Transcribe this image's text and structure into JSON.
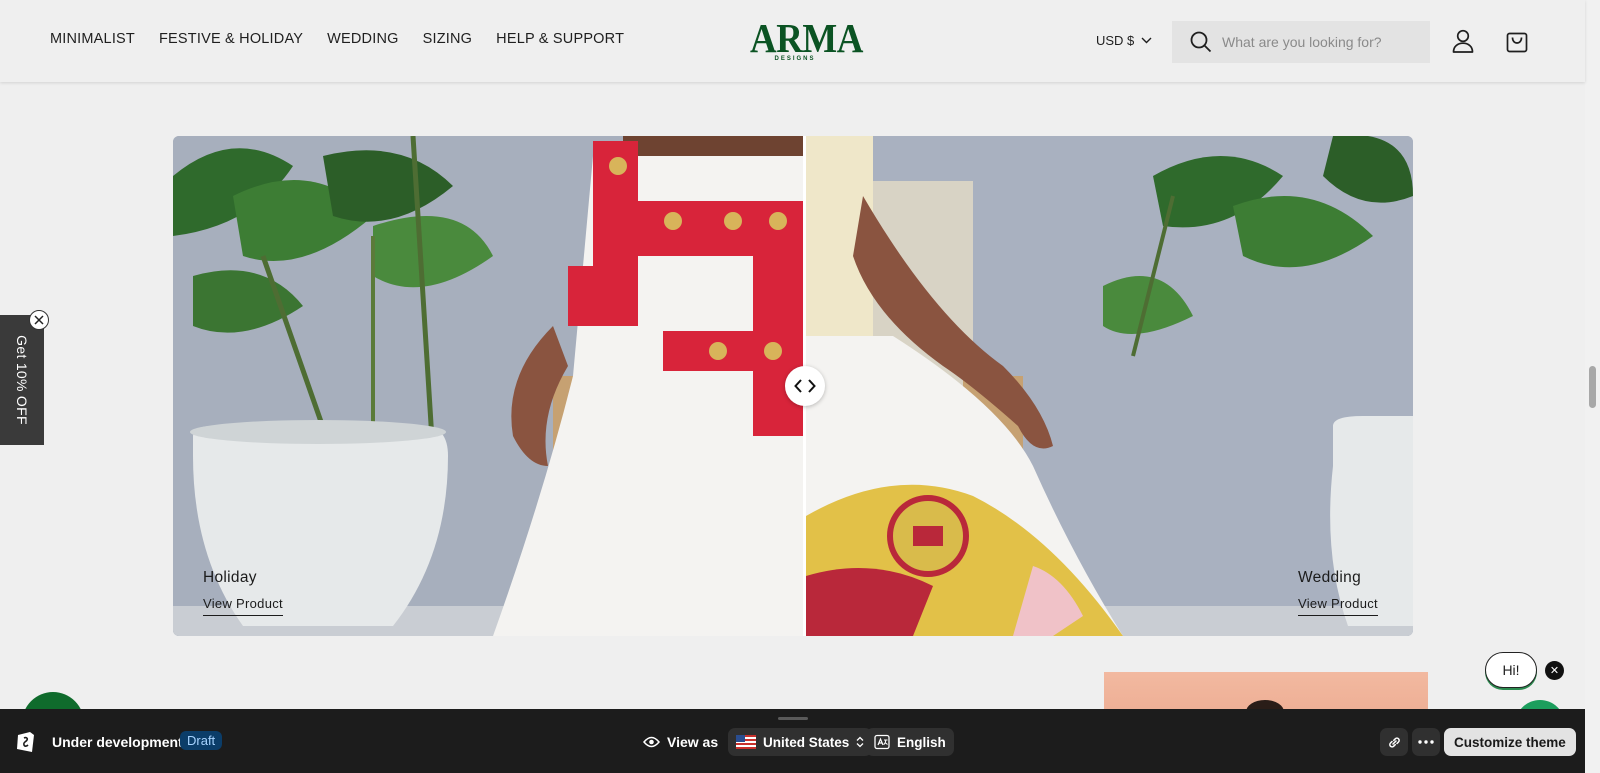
{
  "header": {
    "nav": [
      {
        "label": "MINIMALIST"
      },
      {
        "label": "FESTIVE & HOLIDAY"
      },
      {
        "label": "WEDDING"
      },
      {
        "label": "SIZING"
      },
      {
        "label": "HELP & SUPPORT"
      }
    ],
    "logo": {
      "brand": "ARMA",
      "sub": "DESIGNS"
    },
    "currency": "USD $",
    "search": {
      "placeholder": "What are you looking for?"
    }
  },
  "compare": {
    "left": {
      "title": "Holiday",
      "link": "View Product"
    },
    "right": {
      "title": "Wedding",
      "link": "View Product"
    }
  },
  "promo": {
    "label": "Get 10% OFF"
  },
  "chat": {
    "label": "Hi!"
  },
  "admin_bar": {
    "status": "Under development",
    "badge": "Draft",
    "view_as": "View as",
    "country": "United States",
    "language": "English",
    "customize": "Customize theme"
  },
  "colors": {
    "brand": "#0b5323",
    "bar_bg": "#1c1c1c",
    "draft_badge": "#0b3d69",
    "chat_accent": "#2c8b50"
  },
  "icons": [
    "search-icon",
    "account-icon",
    "cart-icon",
    "chevron-down-icon",
    "compare-arrows-icon",
    "close-icon",
    "shopify-icon",
    "eye-icon",
    "us-flag-icon",
    "updown-chevron-icon",
    "translate-icon",
    "link-icon",
    "more-icon"
  ]
}
